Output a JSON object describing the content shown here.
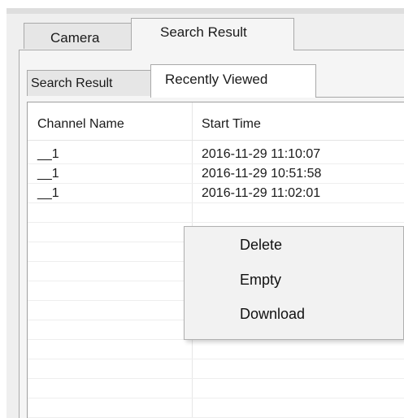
{
  "tabs_top": [
    {
      "label": "Camera"
    },
    {
      "label": "Search Result"
    }
  ],
  "tabs_inner": [
    {
      "label": "Search Result"
    },
    {
      "label": "Recently Viewed"
    }
  ],
  "list": {
    "columns": [
      "Channel Name",
      "Start Time"
    ],
    "rows": [
      {
        "channel": "__1",
        "start_time": "2016-11-29 11:10:07"
      },
      {
        "channel": "__1",
        "start_time": "2016-11-29 10:51:58"
      },
      {
        "channel": "__1",
        "start_time": "2016-11-29 11:02:01"
      }
    ]
  },
  "context_menu": {
    "items": [
      {
        "label": "Delete"
      },
      {
        "label": "Empty"
      },
      {
        "label": "Download"
      }
    ]
  }
}
